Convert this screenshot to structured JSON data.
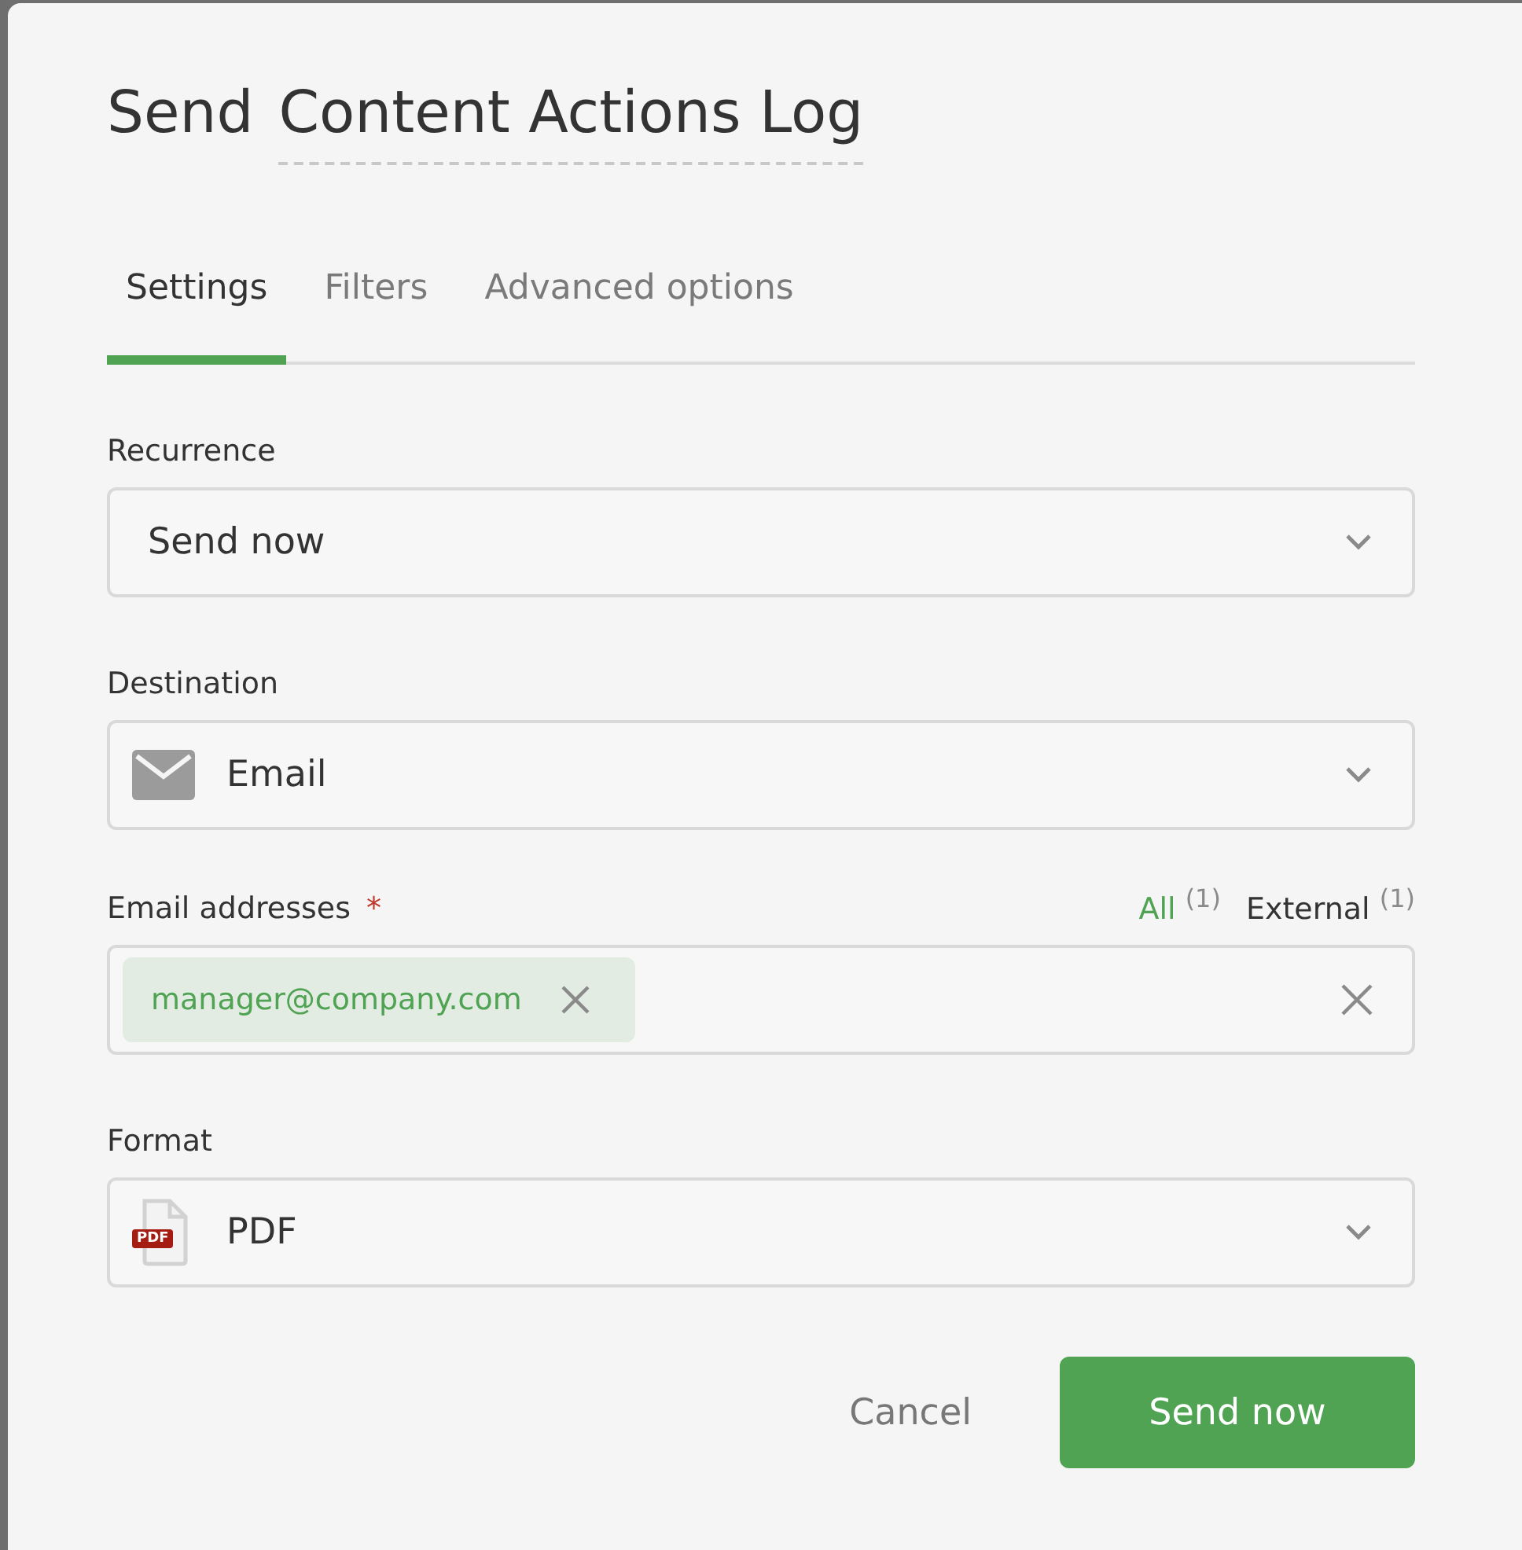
{
  "dialog": {
    "title_prefix": "Send",
    "title": "Content Actions Log"
  },
  "tabs": [
    {
      "label": "Settings",
      "selected": true
    },
    {
      "label": "Filters",
      "selected": false
    },
    {
      "label": "Advanced options",
      "selected": false
    }
  ],
  "recurrence": {
    "label": "Recurrence",
    "value": "Send now"
  },
  "destination": {
    "label": "Destination",
    "value": "Email"
  },
  "email": {
    "label": "Email addresses",
    "required_mark": "*",
    "filters": [
      {
        "label": "All",
        "count": "(1)",
        "selected": true
      },
      {
        "label": "External",
        "count": "(1)",
        "selected": false
      }
    ],
    "chips": [
      "manager@company.com"
    ]
  },
  "format": {
    "label": "Format",
    "value": "PDF",
    "badge": "PDF"
  },
  "buttons": [
    {
      "label": "Cancel",
      "kind": "secondary"
    },
    {
      "label": "Send now",
      "kind": "primary"
    }
  ]
}
